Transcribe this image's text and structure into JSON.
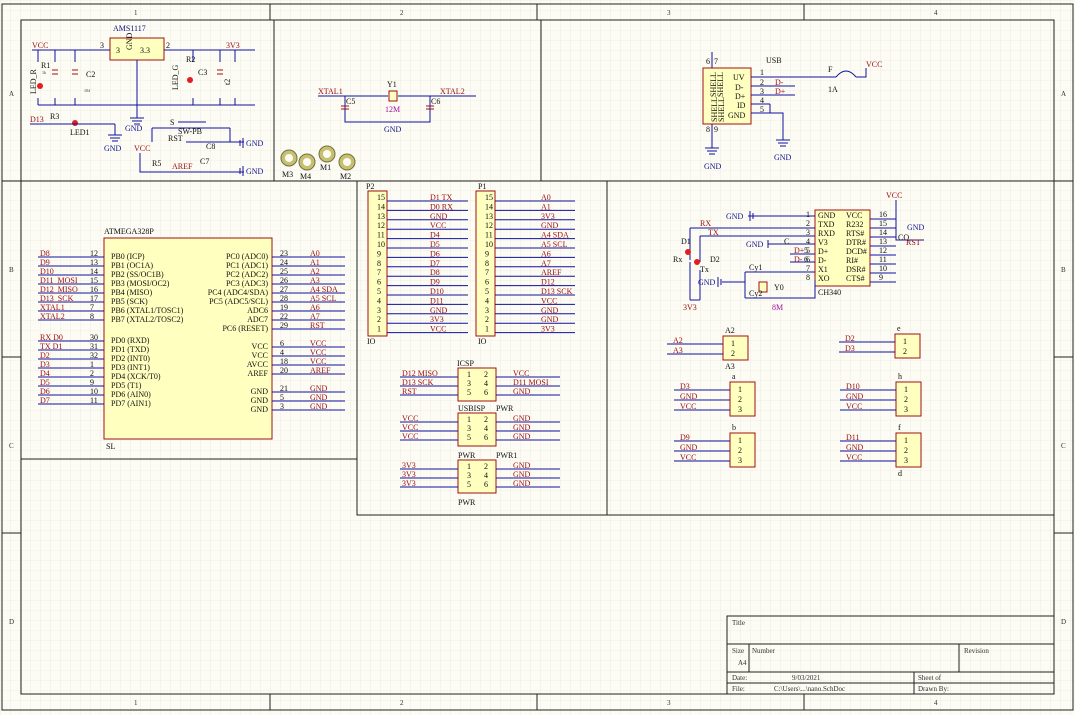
{
  "frame": {
    "cols": [
      "1",
      "2",
      "3",
      "4"
    ],
    "rows": [
      "A",
      "B",
      "C",
      "D"
    ]
  },
  "power": {
    "reg_name": "AMS1117",
    "reg_pin3": "3",
    "reg_gnd": "GND",
    "reg_33": "3.3",
    "reg_pin2": "2",
    "reg_pin3_left": "3",
    "vcc": "VCC",
    "v33": "3V3",
    "r1": "R1",
    "r1_val": "1k",
    "led_r": "LED_R",
    "c2": "C2",
    "c2_val": "104",
    "r2": "R2",
    "led_g": "LED_G",
    "c3": "C3",
    "t2": "t2",
    "gnd": "GND",
    "d13": "D13",
    "r3": "R3",
    "led1": "LED1",
    "s": "S",
    "sw": "SW-PB",
    "rst": "RST",
    "c8": "C8",
    "r5": "R5",
    "aref": "AREF",
    "c7": "C7",
    "tiny_104": "104"
  },
  "crystal": {
    "xtal1": "XTAL1",
    "xtal2": "XTAL2",
    "y1": "Y1",
    "freq": "12M",
    "c5": "C5",
    "c6": "C6",
    "gnd": "GND",
    "holes": [
      "M3",
      "M4",
      "M1",
      "M2"
    ]
  },
  "usb": {
    "title": "USB",
    "shells": [
      "SHELL",
      "SHELL",
      "SHELL",
      "SHELL"
    ],
    "pins": [
      "UV",
      "D-",
      "D+",
      "ID",
      "GND"
    ],
    "nums": [
      "1",
      "2",
      "3",
      "4",
      "5"
    ],
    "nets": [
      "D-",
      "D+"
    ],
    "fuse": "F",
    "fuse_val": "1A",
    "vcc": "VCC",
    "gnd1": "GND",
    "gnd2": "GND",
    "sh_nums": [
      "6",
      "7",
      "8",
      "9"
    ]
  },
  "mcu": {
    "name": "ATMEGA328P",
    "footer": "SL",
    "left": [
      {
        "net": "D8",
        "num": "12",
        "pin": "PB0 (ICP)"
      },
      {
        "net": "D9",
        "num": "13",
        "pin": "PB1 (OC1A)"
      },
      {
        "net": "D10",
        "num": "14",
        "pin": "PB2 (SS/OC1B)"
      },
      {
        "net": "D11_MOSI",
        "num": "15",
        "pin": "PB3 (MOSI/OC2)"
      },
      {
        "net": "D12_MISO",
        "num": "16",
        "pin": "PB4 (MISO)"
      },
      {
        "net": "D13_SCK",
        "num": "17",
        "pin": "PB5 (SCK)"
      },
      {
        "net": "XTAL1",
        "num": "7",
        "pin": "PB6 (XTAL1/TOSC1)"
      },
      {
        "net": "XTAL2",
        "num": "8",
        "pin": "PB7 (XTAL2/TOSC2)"
      },
      {
        "net": "RX   D0",
        "num": "30",
        "pin": "PD0 (RXD)"
      },
      {
        "net": "TX   D1",
        "num": "31",
        "pin": "PD1 (TXD)"
      },
      {
        "net": "D2",
        "num": "32",
        "pin": "PD2 (INT0)"
      },
      {
        "net": "D3",
        "num": "1",
        "pin": "PD3 (INT1)"
      },
      {
        "net": "D4",
        "num": "2",
        "pin": "PD4 (XCK/T0)"
      },
      {
        "net": "D5",
        "num": "9",
        "pin": "PD5 (T1)"
      },
      {
        "net": "D6",
        "num": "10",
        "pin": "PD6 (AIN0)"
      },
      {
        "net": "D7",
        "num": "11",
        "pin": "PD7 (AIN1)"
      }
    ],
    "right": [
      {
        "pin": "PC0 (ADC0)",
        "num": "23",
        "net": "A0"
      },
      {
        "pin": "PC1 (ADC1)",
        "num": "24",
        "net": "A1"
      },
      {
        "pin": "PC2 (ADC2)",
        "num": "25",
        "net": "A2"
      },
      {
        "pin": "PC3 (ADC3)",
        "num": "26",
        "net": "A3"
      },
      {
        "pin": "PC4 (ADC4/SDA)",
        "num": "27",
        "net": "A4   SDA"
      },
      {
        "pin": "PC5 (ADC5/SCL)",
        "num": "28",
        "net": "A5   SCL"
      },
      {
        "pin": "ADC6",
        "num": "19",
        "net": "A6"
      },
      {
        "pin": "ADC7",
        "num": "22",
        "net": "A7"
      },
      {
        "pin": "PC6 (RESET)",
        "num": "29",
        "net": "RST"
      },
      {
        "pin": "",
        "num": "",
        "net": ""
      },
      {
        "pin": "VCC",
        "num": "6",
        "net": "VCC"
      },
      {
        "pin": "VCC",
        "num": "4",
        "net": "VCC"
      },
      {
        "pin": "AVCC",
        "num": "18",
        "net": "VCC"
      },
      {
        "pin": "AREF",
        "num": "20",
        "net": "AREF"
      },
      {
        "pin": "",
        "num": "",
        "net": ""
      },
      {
        "pin": "GND",
        "num": "21",
        "net": "GND"
      },
      {
        "pin": "GND",
        "num": "5",
        "net": "GND"
      },
      {
        "pin": "GND",
        "num": "3",
        "net": "GND"
      }
    ]
  },
  "headers": {
    "p2": "P2",
    "p1": "P1",
    "io": "IO",
    "nums": [
      "15",
      "14",
      "13",
      "12",
      "11",
      "10",
      "9",
      "8",
      "7",
      "6",
      "5",
      "4",
      "3",
      "2",
      "1"
    ],
    "p2_nets": [
      "D1   TX",
      "D0   RX",
      "GND",
      "VCC",
      "D4",
      "D5",
      "D6",
      "D7",
      "D8",
      "D9",
      "D10",
      "D11",
      "GND",
      "3V3",
      "VCC"
    ],
    "p1_nets": [
      "A0",
      "A1",
      "3V3",
      "GND",
      "A4   SDA",
      "A5   SCL",
      "A6",
      "A7",
      "AREF",
      "D12",
      "D13  SCK",
      "VCC",
      "GND",
      "GND",
      "3V3"
    ]
  },
  "icsp": {
    "title": "ICSP",
    "left": [
      "D12  MISO",
      "D13  SCK",
      "RST"
    ],
    "right": [
      "VCC",
      "D11  MOSI",
      "GND"
    ],
    "nums": [
      "1",
      "2",
      "3",
      "4",
      "5",
      "6"
    ],
    "usbisp_title": "USBISP",
    "usbisp_right_title": "PWR",
    "usbisp_left": [
      "VCC",
      "VCC",
      "VCC"
    ],
    "usbisp_right": [
      "GND",
      "GND",
      "GND"
    ],
    "pwr_title": "PWR",
    "pwr1_title": "PWR1",
    "pwr_left": [
      "3V3",
      "3V3",
      "3V3"
    ],
    "pwr_right": [
      "GND",
      "GND",
      "GND"
    ]
  },
  "ch340": {
    "name": "CH340",
    "left": [
      "GND",
      "TXD",
      "RXD",
      "V3",
      "D+",
      "D-",
      "X1",
      "XO"
    ],
    "lnums": [
      "1",
      "2",
      "3",
      "4",
      "5",
      "6",
      "7",
      "8"
    ],
    "right": [
      "VCC",
      "R232",
      "RTS#",
      "DTR#",
      "DCD#",
      "RI#",
      "DSR#",
      "CTS#"
    ],
    "rnums": [
      "16",
      "15",
      "14",
      "13",
      "12",
      "11",
      "10",
      "9"
    ],
    "vcc": "VCC",
    "gnd": "GND",
    "rst": "RST",
    "c": "C",
    "cq": "CQ",
    "rx": "RX",
    "tx": "TX",
    "d1": "D1",
    "d2": "D2",
    "rx_led": "Rx",
    "tx_led": "Tx",
    "v33": "3V3",
    "cy1": "Cy1",
    "cy2": "Cy2",
    "y0": "Y0",
    "xfreq": "8M",
    "dp": "D+",
    "dm": "D-",
    "n5": "5",
    "n6": "6"
  },
  "jumpers": [
    {
      "title": "A2",
      "sub": "A3",
      "nets": [
        "A2",
        "A3"
      ],
      "nums": [
        "1",
        "2"
      ]
    },
    {
      "title": "e",
      "sub": "",
      "nets": [
        "D2",
        "D3"
      ],
      "nums": [
        "1",
        "2"
      ]
    },
    {
      "title": "a",
      "sub": "",
      "nets": [
        "D3",
        "GND",
        "VCC"
      ],
      "nums": [
        "1",
        "2",
        "3"
      ]
    },
    {
      "title": "h",
      "sub": "",
      "nets": [
        "D10",
        "GND",
        "VCC"
      ],
      "nums": [
        "1",
        "2",
        "3"
      ]
    },
    {
      "title": "b",
      "sub": "",
      "nets": [
        "D9",
        "GND",
        "VCC"
      ],
      "nums": [
        "1",
        "2",
        "3"
      ]
    },
    {
      "title": "f",
      "sub": "d",
      "nets": [
        "D11",
        "GND",
        "VCC"
      ],
      "nums": [
        "1",
        "2",
        "3"
      ]
    }
  ],
  "titleblock": {
    "title_lbl": "Title",
    "size_lbl": "Size",
    "size_val": "A4",
    "number_lbl": "Number",
    "revision_lbl": "Revision",
    "date_lbl": "Date:",
    "date_val": "9/03/2021",
    "file_lbl": "File:",
    "file_val": "C:\\Users\\...\\nano.SchDoc",
    "sheet_lbl": "Sheet    of",
    "drawn_lbl": "Drawn By:"
  }
}
